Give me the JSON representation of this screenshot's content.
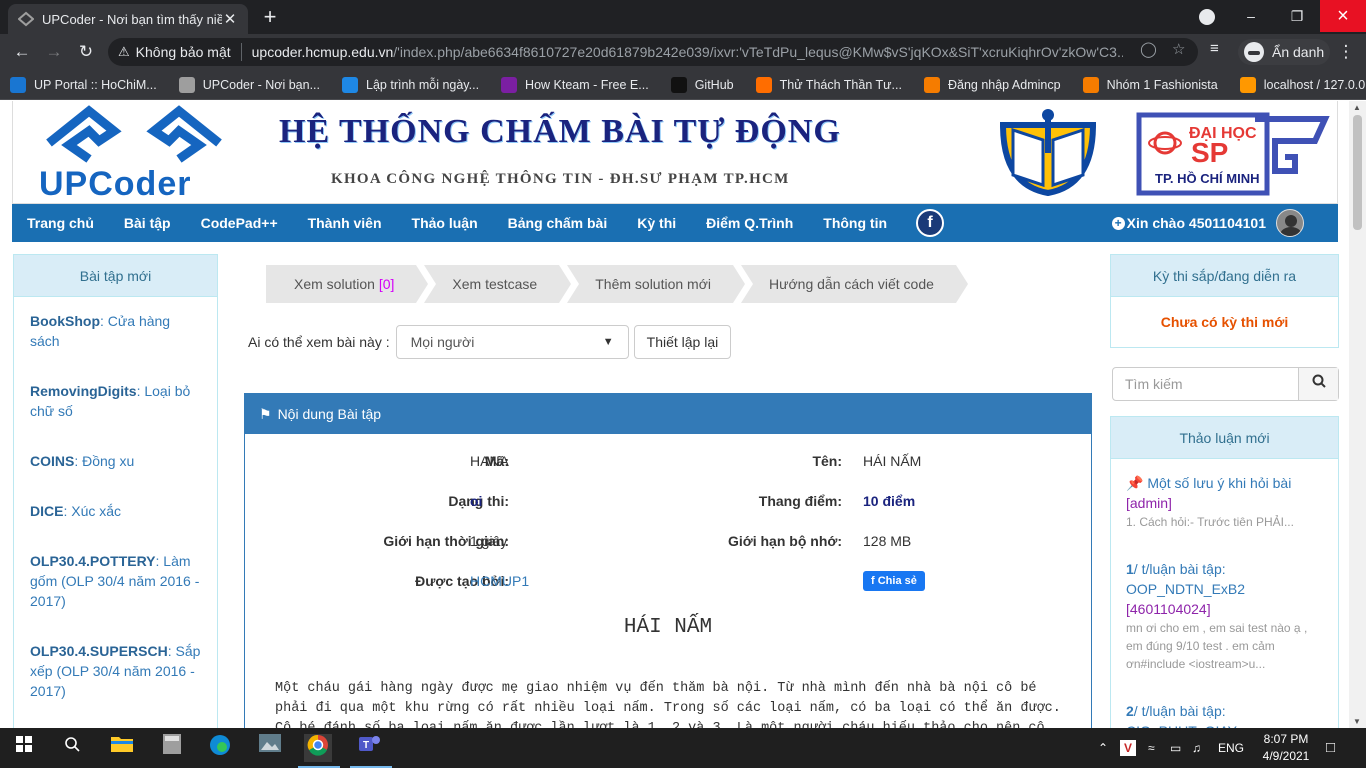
{
  "browser": {
    "tab_title": "UPCoder - Nơi bạn tìm thấy niềm",
    "tab_close": "✕",
    "new_tab": "+",
    "security_label": "Không bảo mật",
    "url_host": "upcoder.hcmup.edu.vn",
    "url_path": "/'index.php/abe6634f8610727e20d61879b242e039/ixvr:'vTeTdPu_lequs@KMw$vS'jqKOx&SiT'xcruKiqhrOv'zkOw'C3...",
    "incognito_label": "Ẩn danh",
    "bookmarks": [
      {
        "label": "UP Portal :: HoChiM...",
        "icon": "up-portal-icon",
        "color": "#1976d2"
      },
      {
        "label": "UPCoder - Nơi bạn...",
        "icon": "upcoder-icon",
        "color": "#9e9e9e"
      },
      {
        "label": "Lập trình mỗi ngày...",
        "icon": "code-icon",
        "color": "#1e88e5"
      },
      {
        "label": "How Kteam - Free E...",
        "icon": "kteam-icon",
        "color": "#7b1fa2"
      },
      {
        "label": "GitHub",
        "icon": "github-icon",
        "color": "#111111"
      },
      {
        "label": "Thử Thách Thần Tư...",
        "icon": "youtube-icon",
        "color": "#ff6d00"
      },
      {
        "label": "Đăng nhập Admincp",
        "icon": "admincp-icon",
        "color": "#f57c00"
      },
      {
        "label": "Nhóm 1 Fashionista",
        "icon": "fashion-icon",
        "color": "#f57c00"
      },
      {
        "label": "localhost / 127.0.0....",
        "icon": "phpmyadmin-icon",
        "color": "#ff9800"
      }
    ]
  },
  "site": {
    "logo_text": "UPCoder",
    "banner_title": "HỆ THỐNG CHẤM BÀI TỰ ĐỘNG",
    "banner_subtitle": "KHOA CÔNG NGHỆ THÔNG TIN - ĐH.SƯ PHẠM TP.HCM",
    "uni_logo": {
      "line1": "ĐẠI HỌC",
      "line2": "SP",
      "line3": "TP. HỒ CHÍ MINH"
    },
    "nav": [
      "Trang chủ",
      "Bài tập",
      "CodePad++",
      "Thành viên",
      "Thảo luận",
      "Bảng chấm bài",
      "Kỳ thi",
      "Điểm Q.Trình",
      "Thông tin"
    ],
    "fb_icon": "f",
    "greeting": "Xin chào 4501104101"
  },
  "left_panel": {
    "title": "Bài tập mới",
    "items": [
      {
        "code": "BookShop",
        "name": ": Cửa hàng sách"
      },
      {
        "code": "RemovingDigits",
        "name": ": Loại bỏ chữ số"
      },
      {
        "code": "COINS",
        "name": ": Đồng xu"
      },
      {
        "code": "DICE",
        "name": ": Xúc xắc"
      },
      {
        "code": "OLP30.4.POTTERY",
        "name": ": Làm gốm (OLP 30/4 năm 2016 - 2017)"
      },
      {
        "code": "OLP30.4.SUPERSCH",
        "name": ": Sắp xếp (OLP 30/4 năm 2016 - 2017)"
      }
    ]
  },
  "right_panel": {
    "contest_title": "Kỳ thi sắp/đang diễn ra",
    "contest_none": "Chưa có kỳ thi mới",
    "search_placeholder": "Tìm kiếm",
    "discuss_title": "Thảo luận mới",
    "discussions": [
      {
        "title": "📌 Một số lưu ý khi hỏi bài",
        "user": "[admin]",
        "excerpt": "1. Cách hỏi:- Trước tiên PHẢI..."
      },
      {
        "title_num": "1",
        "title": "/ t/luận bài tập: OOP_NDTN_ExB2",
        "user": "[4601104024]",
        "excerpt": "mn ơi cho em , em sai test nào ạ , em đúng 9/10 test . em cảm ơn#include <iostream>u..."
      },
      {
        "title_num": "2",
        "title": "/ t/luận bài tập: CIG_PHUT_GIAY",
        "user": "",
        "excerpt": ""
      }
    ]
  },
  "main": {
    "crumbs": [
      {
        "label": "Xem solution ",
        "count": "[0]"
      },
      {
        "label": "Xem testcase",
        "count": ""
      },
      {
        "label": "Thêm solution mới",
        "count": ""
      },
      {
        "label": "Hướng dẫn cách viết code",
        "count": ""
      }
    ],
    "visibility_label": "Ai có thể xem bài này :",
    "visibility_value": "Mọi người",
    "reset_button": "Thiết lập lại",
    "panel_title": "Nội dung Bài tập",
    "fields": {
      "code_label": "Mã:",
      "code_value": "HANA",
      "name_label": "Tên:",
      "name_value": "HÁI NẤM",
      "type_label": "Dạng thi:",
      "type_value": "oi",
      "score_label": "Thang điểm:",
      "score_value": "10 điểm",
      "time_label": "Giới hạn thời gian:",
      "time_value": "1 giây",
      "mem_label": "Giới hạn bộ nhớ:",
      "mem_value": "128 MB",
      "author_label": "Được tạo bởi:",
      "author_value": "HCMUP1",
      "share_label": "Chia sẻ"
    },
    "problem_title": "HÁI NẤM",
    "problem_text": "Một cháu gái hàng ngày được mẹ giao nhiệm vụ đến thăm bà nội. Từ nhà mình đến nhà bà nội cô bé phải đi qua một khu rừng có rất nhiều loại nấm. Trong số các loại nấm, có ba loại có thể ăn được. Cô bé đánh số ba loại nấm ăn được lần lượt là 1, 2 và 3. Là một người cháu hiếu thảo cho nên cô bé quyết định"
  },
  "taskbar": {
    "lang": "ENG",
    "time": "8:07 PM",
    "date": "4/9/2021"
  }
}
